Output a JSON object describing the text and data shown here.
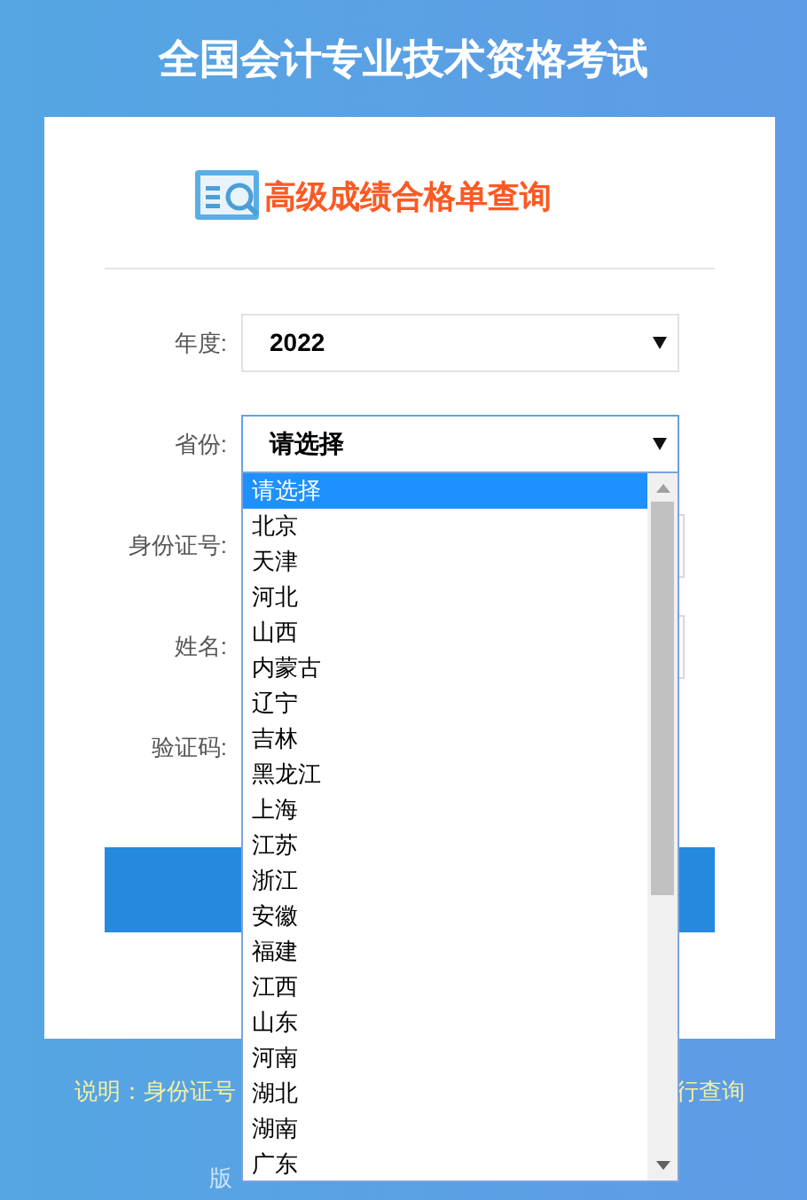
{
  "title": "全国会计专业技术资格考试",
  "subtitle": "高级成绩合格单查询",
  "fields": [
    {
      "label": "年度:",
      "kind": "select",
      "value": "2022",
      "focused": false
    },
    {
      "label": "省份:",
      "kind": "select",
      "value": "请选择",
      "focused": true
    },
    {
      "label": "身份证号:",
      "kind": "input"
    },
    {
      "label": "姓名:",
      "kind": "input"
    },
    {
      "label": "验证码:",
      "kind": "captcha"
    }
  ],
  "dropdown": {
    "options": [
      {
        "label": "请选择",
        "selected": true
      },
      {
        "label": "北京",
        "selected": false
      },
      {
        "label": "天津",
        "selected": false
      },
      {
        "label": "河北",
        "selected": false
      },
      {
        "label": "山西",
        "selected": false
      },
      {
        "label": "内蒙古",
        "selected": false
      },
      {
        "label": "辽宁",
        "selected": false
      },
      {
        "label": "吉林",
        "selected": false
      },
      {
        "label": "黑龙江",
        "selected": false
      },
      {
        "label": "上海",
        "selected": false
      },
      {
        "label": "江苏",
        "selected": false
      },
      {
        "label": "浙江",
        "selected": false
      },
      {
        "label": "安徽",
        "selected": false
      },
      {
        "label": "福建",
        "selected": false
      },
      {
        "label": "江西",
        "selected": false
      },
      {
        "label": "山东",
        "selected": false
      },
      {
        "label": "河南",
        "selected": false
      },
      {
        "label": "湖北",
        "selected": false
      },
      {
        "label": "湖南",
        "selected": false
      },
      {
        "label": "广东",
        "selected": false
      }
    ]
  },
  "note": [
    "说明：身份证号",
    "行查询"
  ],
  "footer": "版"
}
